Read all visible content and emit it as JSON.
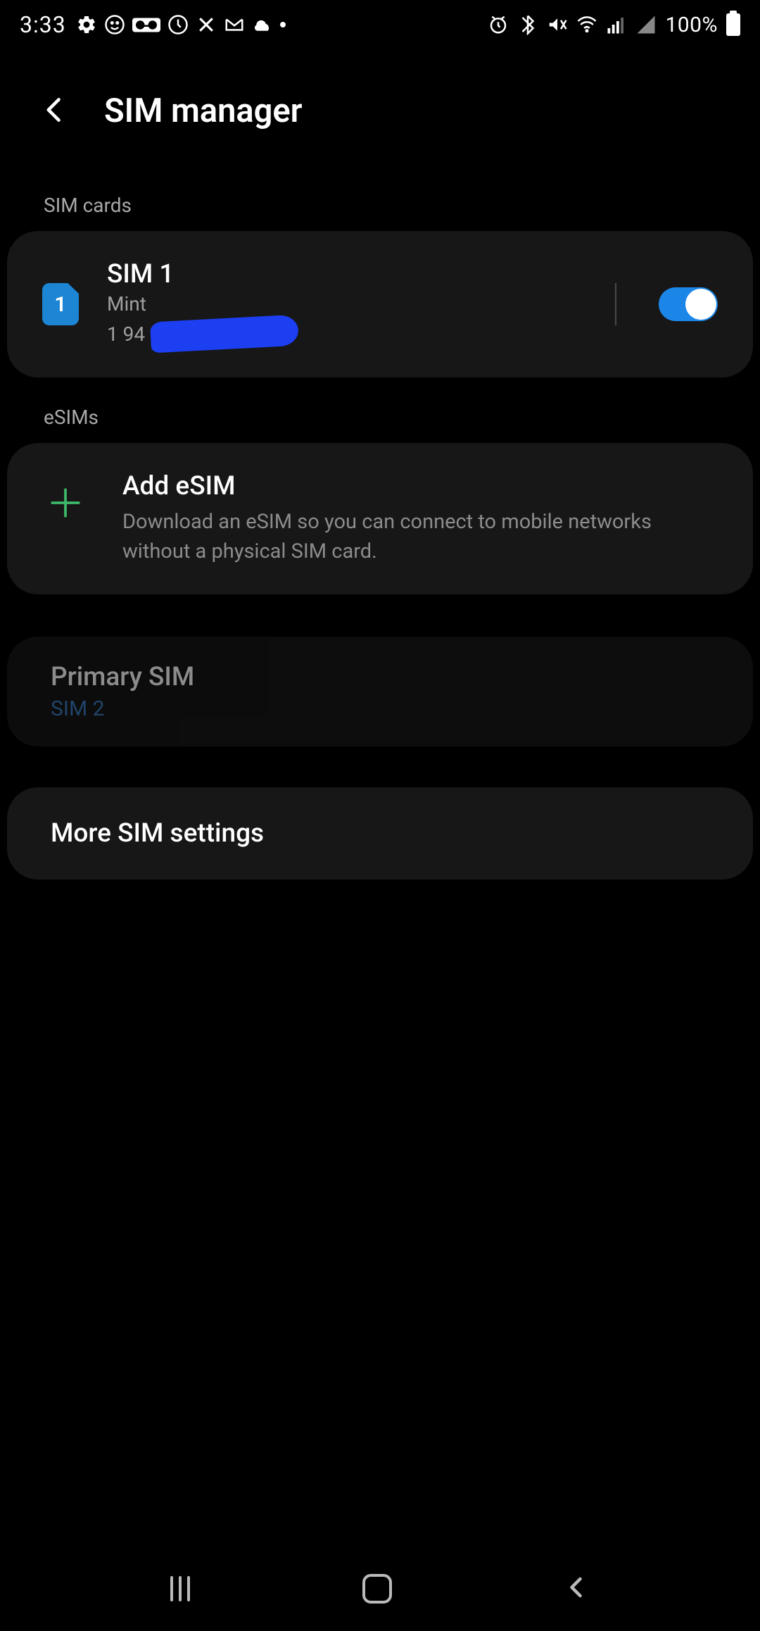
{
  "status_bar": {
    "time": "3:33",
    "battery_percent": "100%"
  },
  "header": {
    "title": "SIM manager"
  },
  "sections": {
    "sim_cards_label": "SIM cards",
    "esims_label": "eSIMs"
  },
  "sim1": {
    "title": "SIM 1",
    "carrier": "Mint",
    "phone_prefix": "1 94",
    "badge_number": "1",
    "toggle_on": true
  },
  "add_esim": {
    "title": "Add eSIM",
    "description": "Download an eSIM so you can connect to mobile networks without a physical SIM card."
  },
  "primary_sim": {
    "title": "Primary SIM",
    "value": "SIM 2"
  },
  "more_settings": {
    "title": "More SIM settings"
  }
}
